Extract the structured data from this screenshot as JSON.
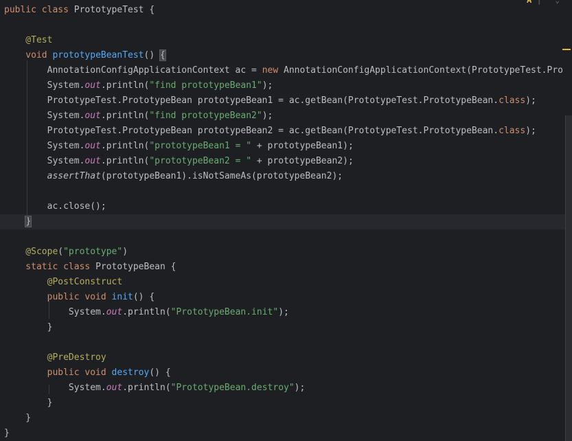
{
  "editor": {
    "lines": [
      {
        "id": "l1",
        "parts": [
          [
            "kw",
            "public class "
          ],
          [
            "plain",
            "PrototypeTest {"
          ]
        ]
      },
      {
        "id": "l2",
        "parts": []
      },
      {
        "id": "l3",
        "parts": [
          [
            "ann",
            "    @Test"
          ]
        ]
      },
      {
        "id": "l4",
        "parts": [
          [
            "kw",
            "    void "
          ],
          [
            "fn",
            "prototypeBeanTest"
          ],
          [
            "plain",
            "() "
          ],
          [
            "bm",
            "{"
          ]
        ]
      },
      {
        "id": "l5",
        "parts": [
          [
            "plain",
            "        AnnotationConfigApplicationContext ac = "
          ],
          [
            "kw",
            "new "
          ],
          [
            "plain",
            "AnnotationConfigApplicationContext(PrototypeTest.Pro"
          ]
        ]
      },
      {
        "id": "l6",
        "parts": [
          [
            "plain",
            "        System."
          ],
          [
            "field",
            "out"
          ],
          [
            "plain",
            ".println("
          ],
          [
            "str",
            "\"find prototypeBean1\""
          ],
          [
            "plain",
            ");"
          ]
        ]
      },
      {
        "id": "l7",
        "parts": [
          [
            "plain",
            "        PrototypeTest.PrototypeBean prototypeBean1 = ac.getBean(PrototypeTest.PrototypeBean."
          ],
          [
            "kw",
            "class"
          ],
          [
            "plain",
            ");"
          ]
        ]
      },
      {
        "id": "l8",
        "parts": [
          [
            "plain",
            "        System."
          ],
          [
            "field",
            "out"
          ],
          [
            "plain",
            ".println("
          ],
          [
            "str",
            "\"find prototypeBean2\""
          ],
          [
            "plain",
            ");"
          ]
        ]
      },
      {
        "id": "l9",
        "parts": [
          [
            "plain",
            "        PrototypeTest.PrototypeBean prototypeBean2 = ac.getBean(PrototypeTest.PrototypeBean."
          ],
          [
            "kw",
            "class"
          ],
          [
            "plain",
            ");"
          ]
        ]
      },
      {
        "id": "l10",
        "parts": [
          [
            "plain",
            "        System."
          ],
          [
            "field",
            "out"
          ],
          [
            "plain",
            ".println("
          ],
          [
            "str",
            "\"prototypeBean1 = \""
          ],
          [
            "plain",
            " + prototypeBean1);"
          ]
        ]
      },
      {
        "id": "l11",
        "parts": [
          [
            "plain",
            "        System."
          ],
          [
            "field",
            "out"
          ],
          [
            "plain",
            ".println("
          ],
          [
            "str",
            "\"prototypeBean2 = \""
          ],
          [
            "plain",
            " + prototypeBean2);"
          ]
        ]
      },
      {
        "id": "l12",
        "parts": [
          [
            "plain",
            "        "
          ],
          [
            "italic",
            "assertThat"
          ],
          [
            "plain",
            "(prototypeBean1).isNotSameAs(prototypeBean2);"
          ]
        ]
      },
      {
        "id": "l13",
        "parts": []
      },
      {
        "id": "l14",
        "parts": [
          [
            "plain",
            "        ac.close();"
          ]
        ]
      },
      {
        "id": "l15",
        "parts": [
          [
            "plain",
            "    "
          ],
          [
            "bm",
            "}"
          ]
        ],
        "current": true
      },
      {
        "id": "l16",
        "parts": []
      },
      {
        "id": "l17",
        "parts": [
          [
            "ann",
            "    @Scope"
          ],
          [
            "plain",
            "("
          ],
          [
            "str",
            "\"prototype\""
          ],
          [
            "plain",
            ")"
          ]
        ]
      },
      {
        "id": "l18",
        "parts": [
          [
            "kw",
            "    static class "
          ],
          [
            "plain",
            "PrototypeBean {"
          ]
        ]
      },
      {
        "id": "l19",
        "parts": [
          [
            "ann",
            "        @PostConstruct"
          ]
        ]
      },
      {
        "id": "l20",
        "parts": [
          [
            "kw",
            "        public void "
          ],
          [
            "fn",
            "init"
          ],
          [
            "plain",
            "() {"
          ]
        ]
      },
      {
        "id": "l21",
        "parts": [
          [
            "plain",
            "            System."
          ],
          [
            "field",
            "out"
          ],
          [
            "plain",
            ".println("
          ],
          [
            "str",
            "\"PrototypeBean.init\""
          ],
          [
            "plain",
            ");"
          ]
        ]
      },
      {
        "id": "l22",
        "parts": [
          [
            "plain",
            "        }"
          ]
        ]
      },
      {
        "id": "l23",
        "parts": []
      },
      {
        "id": "l24",
        "parts": [
          [
            "ann",
            "        @PreDestroy"
          ]
        ]
      },
      {
        "id": "l25",
        "parts": [
          [
            "kw",
            "        public void "
          ],
          [
            "fn",
            "destroy"
          ],
          [
            "plain",
            "() {"
          ]
        ]
      },
      {
        "id": "l26",
        "parts": [
          [
            "plain",
            "            System."
          ],
          [
            "field",
            "out"
          ],
          [
            "plain",
            ".println("
          ],
          [
            "str",
            "\"PrototypeBean.destroy\""
          ],
          [
            "plain",
            ");"
          ]
        ]
      },
      {
        "id": "l27",
        "parts": [
          [
            "plain",
            "        }"
          ]
        ]
      },
      {
        "id": "l28",
        "parts": [
          [
            "plain",
            "    }"
          ]
        ]
      },
      {
        "id": "l29",
        "parts": [
          [
            "plain",
            "}"
          ]
        ]
      }
    ],
    "colors": {
      "background": "#1e1f22",
      "text": "#bcbec4",
      "keyword": "#cf8e6d",
      "annotation": "#b3ae60",
      "string": "#6aab73",
      "method": "#56a8f5",
      "field": "#c77dbb"
    },
    "icons": [
      "warning-icon",
      "inspection-icons",
      "scrollbar"
    ]
  }
}
